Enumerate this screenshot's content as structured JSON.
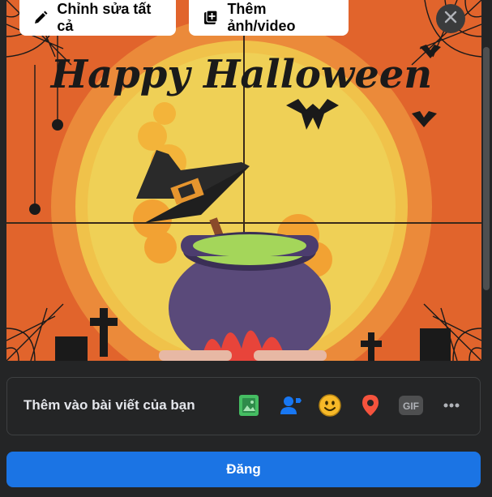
{
  "toolbar": {
    "edit_all_label": "Chỉnh sửa tất cả",
    "add_media_label": "Thêm ảnh/video",
    "close_icon": "close-icon"
  },
  "media": {
    "title_text": "Happy Halloween"
  },
  "add_to_post": {
    "label": "Thêm vào bài viết của bạn",
    "options": [
      {
        "icon": "photo-icon",
        "color": "#45bd62"
      },
      {
        "icon": "tag-people-icon",
        "color": "#1877f2"
      },
      {
        "icon": "feeling-icon",
        "color": "#f7b928"
      },
      {
        "icon": "location-icon",
        "color": "#f5533d"
      },
      {
        "icon": "gif-icon",
        "color": "#4e4f50",
        "text": "GIF"
      },
      {
        "icon": "more-icon",
        "color": "#b0b3b8"
      }
    ]
  },
  "post_button": {
    "label": "Đăng"
  },
  "colors": {
    "accent": "#1b74e4",
    "background": "#242526"
  }
}
